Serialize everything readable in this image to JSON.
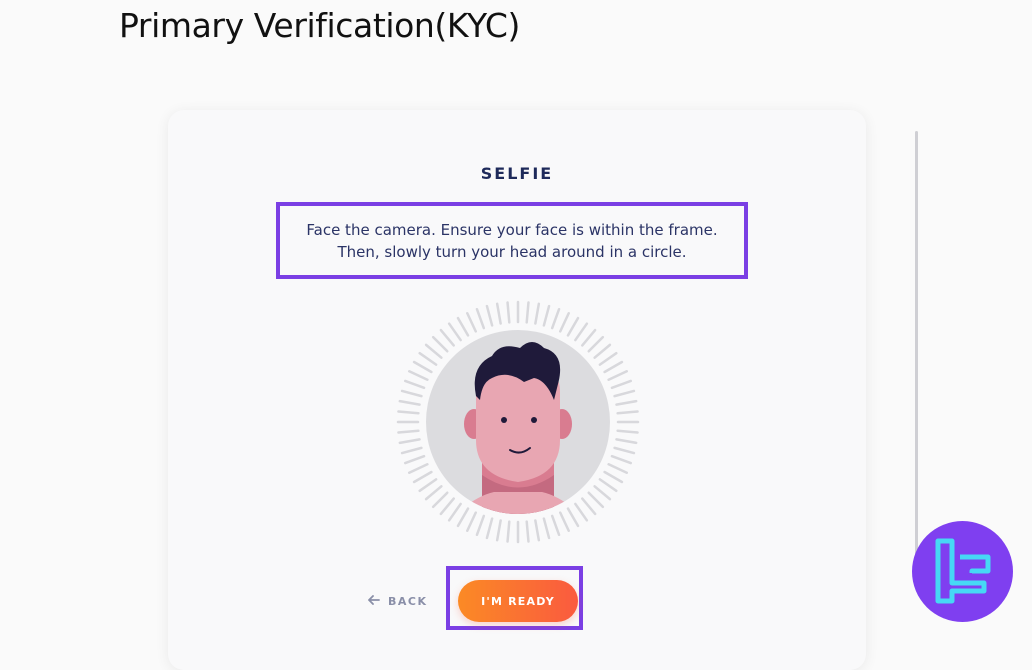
{
  "page": {
    "title": "Primary Verification(KYC)"
  },
  "selfie": {
    "title": "SELFIE",
    "instruction_line1": "Face the camera. Ensure your face is within the frame.",
    "instruction_line2": "Then, slowly turn your head around in a circle."
  },
  "actions": {
    "back_label": "BACK",
    "ready_label": "I'M READY"
  },
  "icons": {
    "back": "arrow-left-icon",
    "avatar": "face-avatar-illustration",
    "logo": "brand-logo"
  },
  "colors": {
    "highlight": "#7b3fe4",
    "button_start": "#fb8a25",
    "button_end": "#fa5a3f",
    "title": "#1e2a5a",
    "logo_bg": "#7f3ff0",
    "logo_stroke": "#46d8f5"
  }
}
